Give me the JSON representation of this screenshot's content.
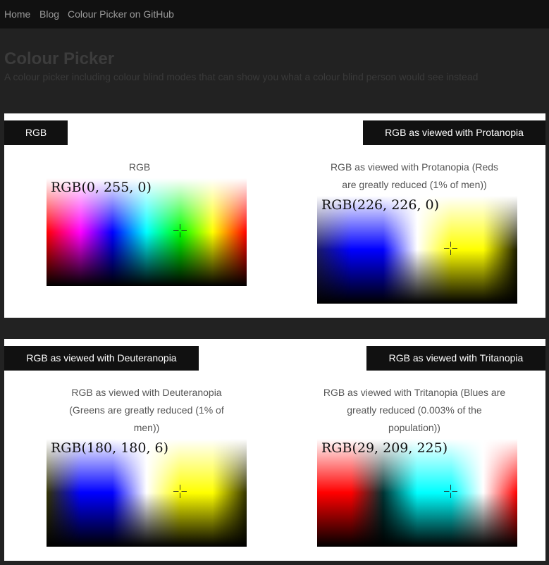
{
  "nav": {
    "home": "Home",
    "blog": "Blog",
    "github": "Colour Picker on GitHub"
  },
  "header": {
    "title": "Colour Picker",
    "subtitle": "A colour picker including colour blind modes that can show you what a colour blind person would see instead"
  },
  "panels": [
    {
      "left_tab": "RGB",
      "right_tab": "RGB as viewed with Protanopia",
      "left": {
        "caption_lines": [
          "RGB"
        ],
        "readout": "RGB(0, 255, 0)"
      },
      "right": {
        "caption_lines": [
          "RGB as viewed with Protanopia (Reds",
          "are greatly reduced (1% of men))"
        ],
        "readout": "RGB(226, 226, 0)"
      }
    },
    {
      "left_tab": "RGB as viewed with Deuteranopia",
      "right_tab": "RGB as viewed with Tritanopia",
      "left": {
        "caption_lines": [
          "RGB as viewed with Deuteranopia",
          "(Greens are greatly reduced (1% of",
          "men))"
        ],
        "readout": "RGB(180, 180, 6)"
      },
      "right": {
        "caption_lines": [
          "RGB as viewed with Tritanopia (Blues are",
          "greatly reduced (0.003% of the",
          "population))"
        ],
        "readout": "RGB(29, 209, 225)"
      }
    }
  ],
  "colors": {
    "page_bg": "#222222",
    "nav_bg": "#111111",
    "panel_bg": "#ffffff",
    "tab_bg": "#111111",
    "tab_text": "#ffffff"
  },
  "icons": {
    "picker_cursor": "crosshair-icon"
  }
}
